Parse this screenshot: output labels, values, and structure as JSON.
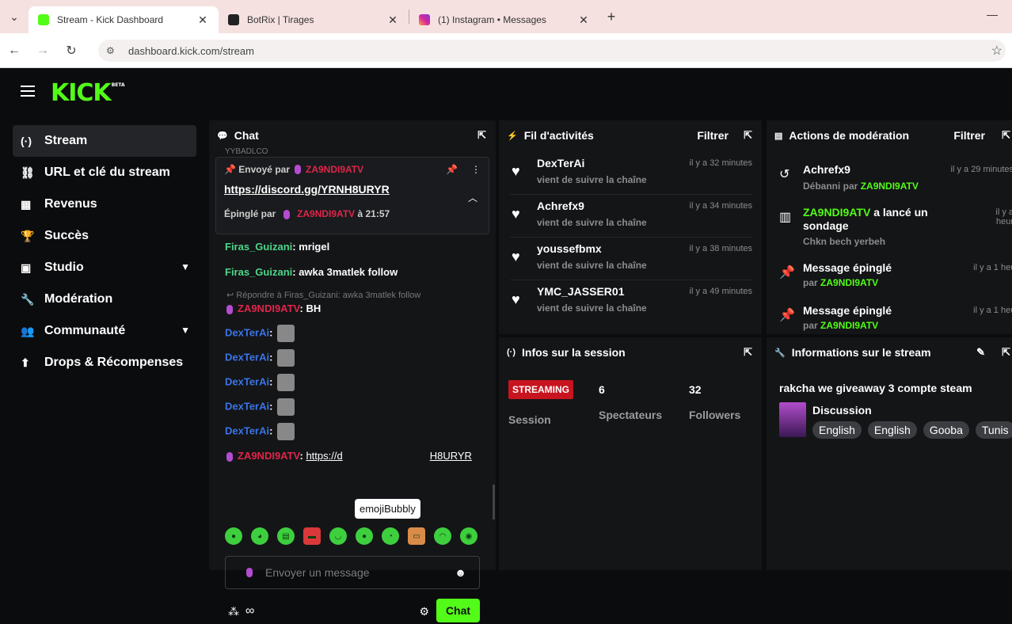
{
  "browser": {
    "tabs": [
      {
        "label": "Stream - Kick Dashboard",
        "favicon_color": "#53fc18",
        "active": true
      },
      {
        "label": "BotRix | Tirages",
        "favicon_color": "#222222",
        "active": false
      },
      {
        "label": "(1) Instagram • Messages",
        "favicon_color": "#d6249f",
        "active": false
      }
    ],
    "url": "dashboard.kick.com/stream"
  },
  "app": {
    "logo": "KICK",
    "logo_badge": "BETA"
  },
  "sidebar": {
    "items": [
      {
        "label": "Stream",
        "icon": "broadcast-icon",
        "glyph": "(·)"
      },
      {
        "label": "URL et clé du stream",
        "icon": "link-icon",
        "glyph": "⛓"
      },
      {
        "label": "Revenus",
        "icon": "revenue-icon",
        "glyph": "▦"
      },
      {
        "label": "Succès",
        "icon": "trophy-icon",
        "glyph": "🏆"
      },
      {
        "label": "Studio",
        "icon": "studio-icon",
        "glyph": "▣"
      },
      {
        "label": "Modération",
        "icon": "wrench-icon",
        "glyph": "🔧"
      },
      {
        "label": "Communauté",
        "icon": "community-icon",
        "glyph": "👥"
      },
      {
        "label": "Drops & Récompenses",
        "icon": "drops-icon",
        "glyph": "⬆"
      }
    ]
  },
  "chat": {
    "title": "Chat",
    "cut_text": "YYBADLCO",
    "pinned": {
      "sent_by_label": "Envoyé par",
      "sent_by_user": "ZA9NDI9ATV",
      "link": "https://discord.gg/YRNH8URYR",
      "pinned_by_label": "Épinglé par",
      "pinned_by_user": "ZA9NDI9ATV",
      "pinned_time": "à 21:57"
    },
    "messages": [
      {
        "user": "Firas_Guizani",
        "text": "mrigel"
      },
      {
        "user": "Firas_Guizani",
        "text": "awka 3matlek follow"
      }
    ],
    "reply_hint": "Répondre à Firas_Guizani: awka 3matlek follow",
    "reply_msg": {
      "user": "ZA9NDI9ATV",
      "text": "BH"
    },
    "emote_msgs": [
      "DexTerAi",
      "DexTerAi",
      "DexTerAi",
      "DexTerAi",
      "DexTerAi"
    ],
    "last_msg": {
      "user": "ZA9NDI9ATV",
      "text": "https://d",
      "text_end": "H8URYR"
    },
    "tooltip": "emojiBubbly",
    "input_placeholder": "Envoyer un message",
    "send_label": "Chat"
  },
  "activity": {
    "title": "Fil d'activités",
    "filter": "Filtrer",
    "items": [
      {
        "user": "DexTerAi",
        "action": "vient de suivre la chaîne",
        "time": "il y a 32 minutes"
      },
      {
        "user": "Achrefx9",
        "action": "vient de suivre la chaîne",
        "time": "il y a 34 minutes"
      },
      {
        "user": "youssefbmx",
        "action": "vient de suivre la chaîne",
        "time": "il y a 38 minutes"
      },
      {
        "user": "YMC_JASSER01",
        "action": "vient de suivre la chaîne",
        "time": "il y a 49 minutes"
      }
    ]
  },
  "moderation": {
    "title": "Actions de modération",
    "filter": "Filtrer",
    "items": [
      {
        "title": "Achrefx9",
        "sub_prefix": "Débanni par",
        "sub_user": "ZA9NDI9ATV",
        "time": "il y a 29 minutes"
      },
      {
        "title_user": "ZA9NDI9ATV",
        "title": "a lancé un sondage",
        "sub_text": "Chkn bech yerbeh",
        "time": "il y a heur"
      },
      {
        "title": "Message épinglé",
        "sub_prefix": "par",
        "sub_user": "ZA9NDI9ATV",
        "time": "il y a 1 heur"
      },
      {
        "title": "Message épinglé",
        "sub_prefix": "par",
        "sub_user": "ZA9NDI9ATV",
        "time": "il y a 1 heur"
      }
    ]
  },
  "session": {
    "title": "Infos sur la session",
    "badge": "STREAMING",
    "session_label": "Session",
    "viewers_value": "6",
    "viewers_label": "Spectateurs",
    "followers_value": "32",
    "followers_label": "Followers"
  },
  "streaminfo": {
    "title": "Informations sur le stream",
    "stream_title": "rakcha we giveaway 3 compte steam",
    "category": "Discussion",
    "tags": [
      "English",
      "English",
      "Gooba",
      "Tunis"
    ]
  }
}
